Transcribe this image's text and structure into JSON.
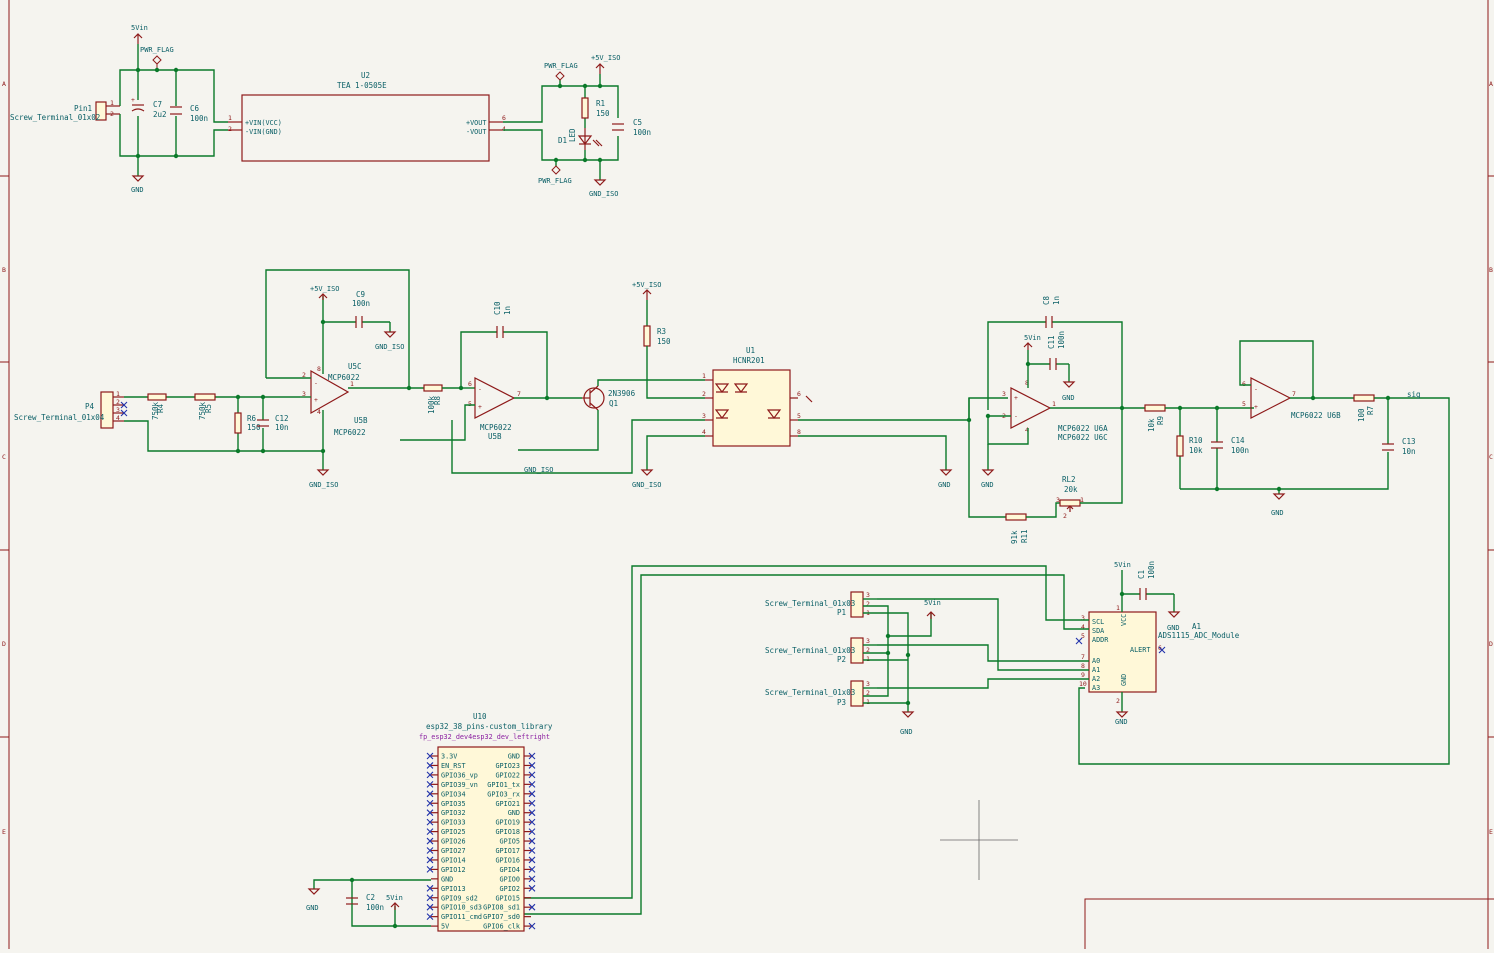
{
  "sheet": {
    "border_color": "#8e1a1a",
    "wire_color": "#0b7a2a",
    "text_color": "#0a5f66",
    "background": "#f5f4ef"
  },
  "border_letters": [
    "A",
    "B",
    "C",
    "D",
    "E"
  ],
  "power": {
    "vin": "5Vin",
    "gnd": "GND",
    "iso5v": "+5V_ISO",
    "gndiso": "GND_ISO",
    "pwrflag": "PWR_FLAG"
  },
  "pin1": {
    "ref": "Pin1",
    "value": "Screw_Terminal_01x02"
  },
  "c7": {
    "ref": "C7",
    "value": "2u2"
  },
  "c6": {
    "ref": "C6",
    "value": "100n"
  },
  "u2": {
    "ref": "U2",
    "value": "TEA 1-0505E",
    "vin_vcc": "+VIN(VCC)",
    "vin_gnd": "-VIN(GND)",
    "vout_p": "+VOUT",
    "vout_n": "-VOUT"
  },
  "r1": {
    "ref": "R1",
    "value": "150"
  },
  "d1": {
    "ref": "D1",
    "value": "LED"
  },
  "c5": {
    "ref": "C5",
    "value": "100n"
  },
  "p4": {
    "ref": "P4",
    "value": "Screw_Terminal_01x04"
  },
  "r4": {
    "ref": "R4",
    "value": "750k"
  },
  "r5": {
    "ref": "R5",
    "value": "750k"
  },
  "r6": {
    "ref": "R6",
    "value": "150"
  },
  "c12": {
    "ref": "C12",
    "value": "10n"
  },
  "c9": {
    "ref": "C9",
    "value": "100n"
  },
  "u5c": {
    "ref": "U5C",
    "value": "MCP6022"
  },
  "u5b": {
    "ref": "U5B",
    "value": "MCP6022"
  },
  "r8": {
    "ref": "R8",
    "value": "100k"
  },
  "c10": {
    "ref": "C10",
    "value": "1n"
  },
  "r3": {
    "ref": "R3",
    "value": "150"
  },
  "q1": {
    "ref": "Q1",
    "value": "2N3906"
  },
  "u1": {
    "ref": "U1",
    "value": "HCNR201"
  },
  "c8": {
    "ref": "C8",
    "value": "1n"
  },
  "c11": {
    "ref": "C11",
    "value": "100n"
  },
  "u6": {
    "a": "MCP6022 U6A",
    "c": "MCP6022 U6C",
    "b": "MCP6022 U6B"
  },
  "rl2": {
    "ref": "RL2",
    "value": "20k"
  },
  "r11": {
    "ref": "R11",
    "value": "91k"
  },
  "r9": {
    "ref": "R9",
    "value": "10k"
  },
  "r10": {
    "ref": "R10",
    "value": "10k"
  },
  "c14": {
    "ref": "C14",
    "value": "100n"
  },
  "r7": {
    "ref": "R7",
    "value": "100"
  },
  "c13": {
    "ref": "C13",
    "value": "10n"
  },
  "sig": "sig",
  "c1": {
    "ref": "C1",
    "value": "100n"
  },
  "a1": {
    "ref": "A1",
    "value": "ADS1115_ADC_Module",
    "scl": "SCL",
    "sda": "SDA",
    "addr": "ADDR",
    "alert": "ALERT",
    "a0": "A0",
    "a1p": "A1",
    "a2": "A2",
    "a3": "A3",
    "vcc": "VCC",
    "gnd": "GND"
  },
  "p1": {
    "ref": "P1",
    "value": "Screw_Terminal_01x03"
  },
  "p2": {
    "ref": "P2",
    "value": "Screw_Terminal_01x03"
  },
  "p3": {
    "ref": "P3",
    "value": "Screw_Terminal_01x03"
  },
  "u10": {
    "ref": "U10",
    "value": "esp32_38_pins-custom_library",
    "footprint": "fp_esp32_dev4esp32_dev_leftright",
    "left_pins": [
      "3.3V",
      "EN_RST",
      "GPIO36_vp",
      "GPIO39_vn",
      "GPIO34",
      "GPIO35",
      "GPIO32",
      "GPIO33",
      "GPIO25",
      "GPIO26",
      "GPIO27",
      "GPIO14",
      "GPIO12",
      "GND",
      "GPIO13",
      "GPIO9_sd2",
      "GPIO10_sd3",
      "GPIO11_cmd",
      "5V"
    ],
    "right_pins": [
      "GND",
      "GPIO23",
      "GPIO22",
      "GPIO1_tx",
      "GPIO3_rx",
      "GPIO21",
      "GND",
      "GPIO19",
      "GPIO18",
      "GPIO5",
      "GPIO17",
      "GPIO16",
      "GPIO4",
      "GPIO0",
      "GPIO2",
      "GPIO15",
      "GPIO8_sd1",
      "GPIO7_sd0",
      "GPIO6_clk"
    ]
  },
  "c2": {
    "ref": "C2",
    "value": "100n"
  }
}
